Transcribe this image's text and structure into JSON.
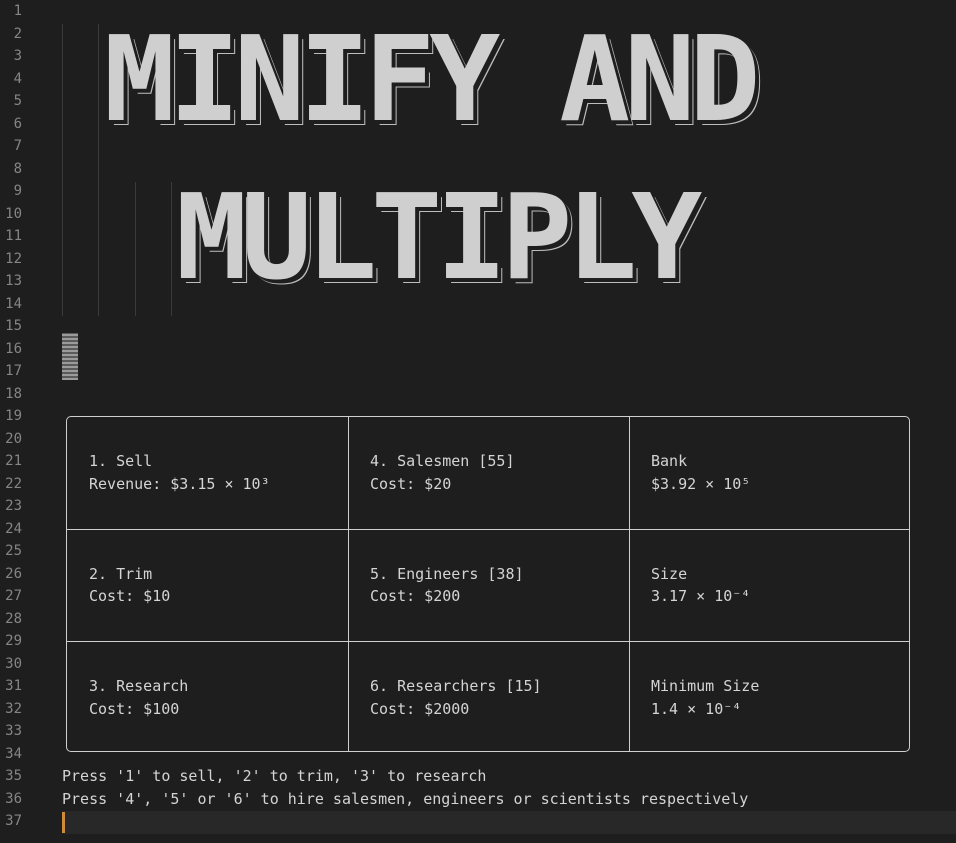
{
  "line_numbers": [
    "1",
    "2",
    "3",
    "4",
    "5",
    "6",
    "7",
    "8",
    "9",
    "10",
    "11",
    "12",
    "13",
    "14",
    "15",
    "16",
    "17",
    "18",
    "19",
    "20",
    "21",
    "22",
    "23",
    "24",
    "25",
    "26",
    "27",
    "28",
    "29",
    "30",
    "31",
    "32",
    "33",
    "34",
    "35",
    "36",
    "37"
  ],
  "banner": {
    "line1": "MINIFY AND",
    "line2": "MULTIPLY"
  },
  "panel": {
    "rows": [
      {
        "col1": {
          "title": "1. Sell",
          "detail": "Revenue: $3.15 × 10³"
        },
        "col2": {
          "title": "4. Salesmen [55]",
          "detail": "Cost: $20"
        },
        "col3": {
          "title": "Bank",
          "detail": "$3.92 × 10⁵"
        }
      },
      {
        "col1": {
          "title": "2. Trim",
          "detail": "Cost: $10"
        },
        "col2": {
          "title": "5. Engineers [38]",
          "detail": "Cost: $200"
        },
        "col3": {
          "title": "Size",
          "detail": "3.17 × 10⁻⁴"
        }
      },
      {
        "col1": {
          "title": "3. Research",
          "detail": "Cost: $100"
        },
        "col2": {
          "title": "6. Researchers [15]",
          "detail": "Cost: $2000"
        },
        "col3": {
          "title": "Minimum Size",
          "detail": "1.4 × 10⁻⁴"
        }
      }
    ]
  },
  "help": {
    "line1": "Press '1' to sell, '2' to trim, '3' to research",
    "line2": "Press '4', '5' or '6' to hire salesmen, engineers or scientists respectively"
  },
  "colors": {
    "background": "#1e1e1e",
    "text": "#d4d4d4",
    "line_number": "#858585",
    "caret": "#d18a3a"
  }
}
